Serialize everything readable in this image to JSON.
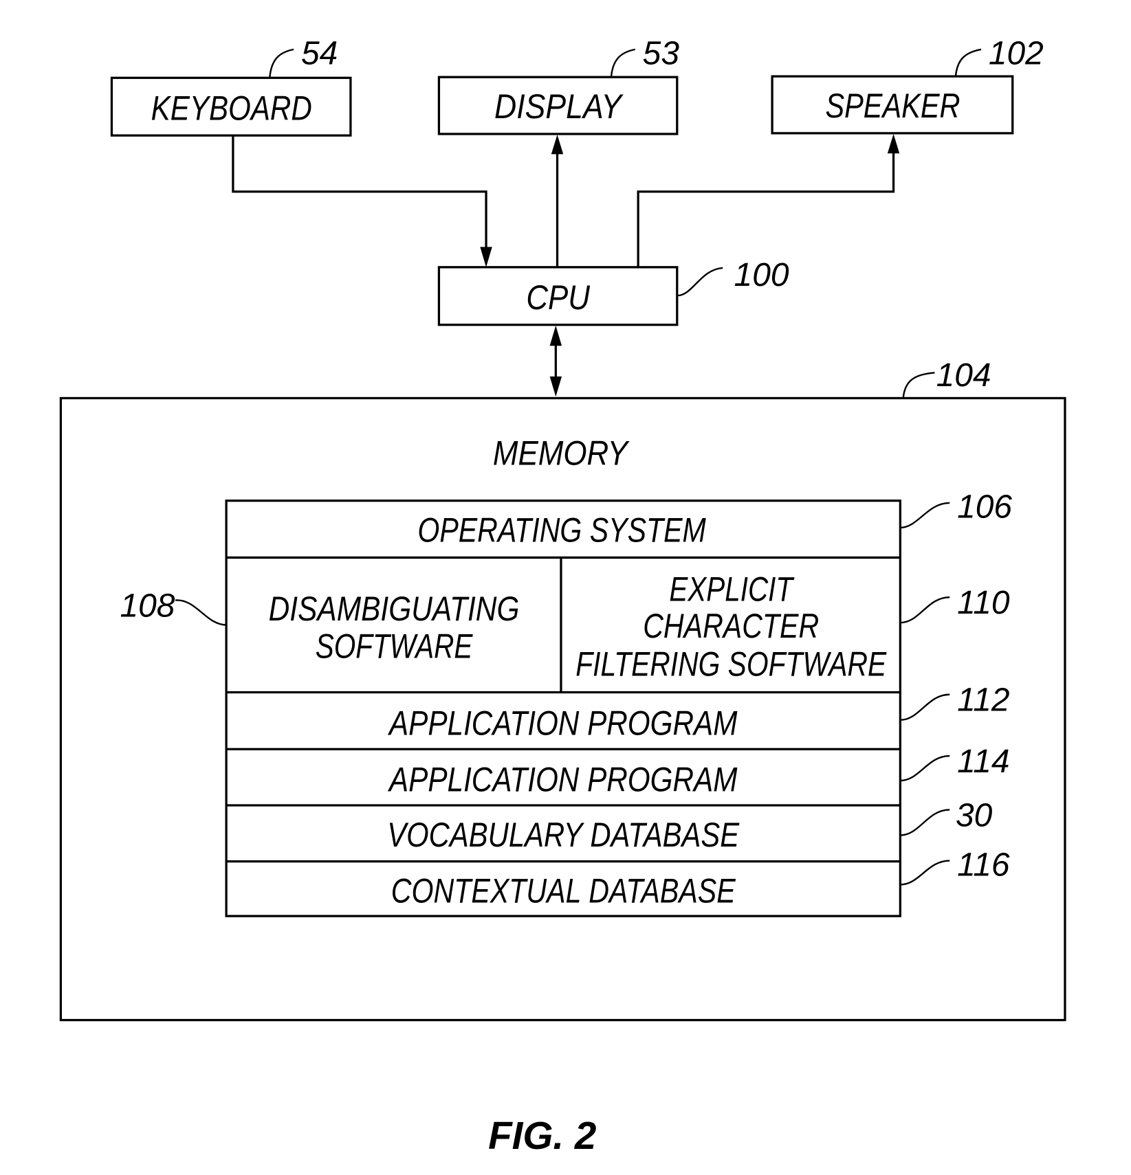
{
  "figure": {
    "caption": "FIG. 2",
    "peripherals": {
      "keyboard": {
        "label": "KEYBOARD",
        "ref": "54"
      },
      "display": {
        "label": "DISPLAY",
        "ref": "53"
      },
      "speaker": {
        "label": "SPEAKER",
        "ref": "102"
      }
    },
    "cpu": {
      "label": "CPU",
      "ref": "100"
    },
    "memory": {
      "label": "MEMORY",
      "ref": "104",
      "layers": {
        "operating_system": {
          "label": "OPERATING SYSTEM",
          "ref": "106"
        },
        "disambiguating_software": {
          "lines": [
            "DISAMBIGUATING",
            "SOFTWARE"
          ],
          "ref": "108"
        },
        "explicit_filtering_software": {
          "lines": [
            "EXPLICIT",
            "CHARACTER",
            "FILTERING SOFTWARE"
          ],
          "ref": "110"
        },
        "application_program_1": {
          "label": "APPLICATION PROGRAM",
          "ref": "112"
        },
        "application_program_2": {
          "label": "APPLICATION PROGRAM",
          "ref": "114"
        },
        "vocabulary_database": {
          "label": "VOCABULARY DATABASE",
          "ref": "30"
        },
        "contextual_database": {
          "label": "CONTEXTUAL DATABASE",
          "ref": "116"
        }
      }
    }
  }
}
